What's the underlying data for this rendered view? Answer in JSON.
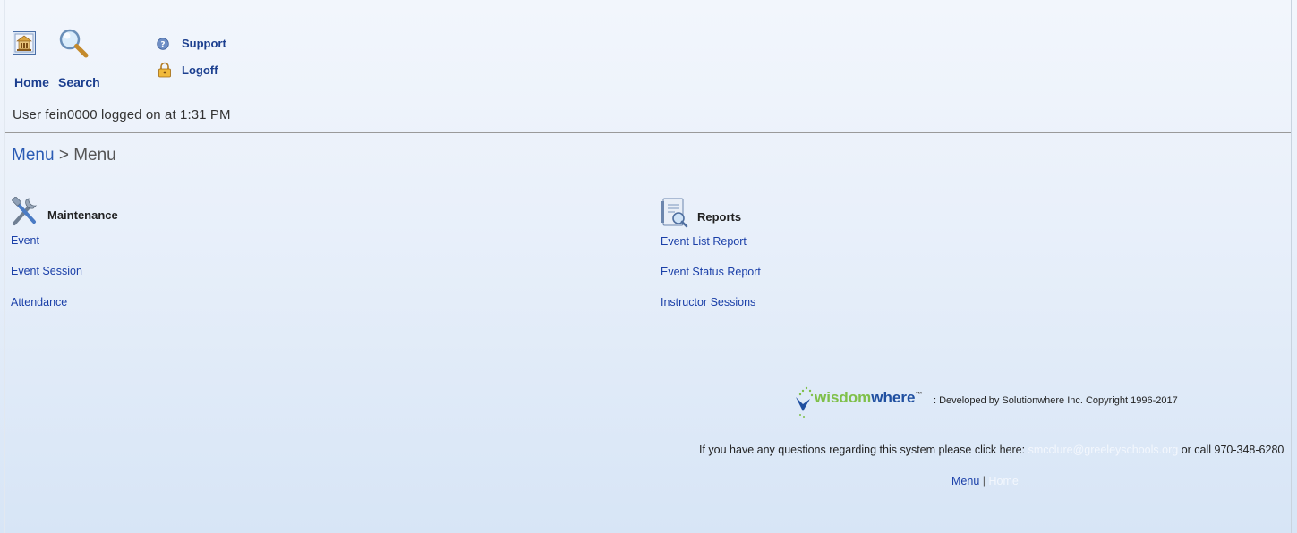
{
  "header": {
    "home_label": "Home",
    "search_label": "Search",
    "support_label": "Support",
    "logoff_label": "Logoff",
    "user_status": "User fein0000 logged on at 1:31 PM"
  },
  "breadcrumb": {
    "root": "Menu",
    "separator": ">",
    "current": "Menu"
  },
  "sections": {
    "maintenance": {
      "title": "Maintenance",
      "items": [
        "Event",
        "Event Session",
        "Attendance"
      ]
    },
    "reports": {
      "title": "Reports",
      "items": [
        "Event List Report",
        "Event Status Report",
        "Instructor Sessions"
      ]
    }
  },
  "footer": {
    "brand_part1": "wisdom",
    "brand_part2": "where",
    "brand_tm": "™",
    "copyright": ": Developed by Solutionwhere Inc. Copyright 1996-2017",
    "question_prefix": "If you have any questions regarding this system please click here:",
    "contact_email": "smcclure@greeleyschools.org",
    "question_suffix": "or call 970-348-6280",
    "menu_link": "Menu",
    "separator": "|",
    "home_link": "Home"
  },
  "colors": {
    "link": "#1a3fa8",
    "breadcrumb_link": "#2a5bb4",
    "brand_green": "#7fc04a",
    "brand_blue": "#1f4fa0"
  }
}
